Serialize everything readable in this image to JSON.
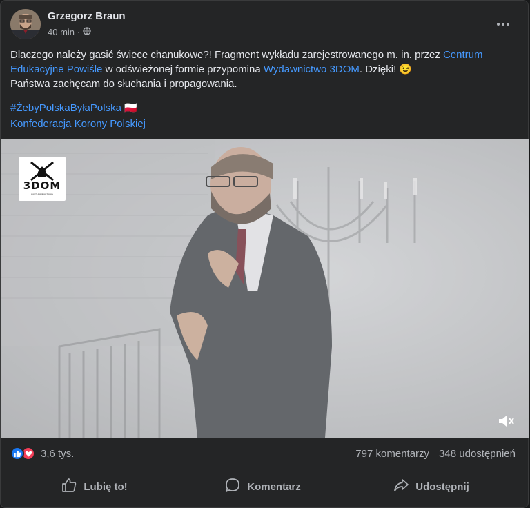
{
  "post": {
    "author": "Grzegorz Braun",
    "time": "40 min",
    "separator": "·",
    "visibility_icon": "globe-icon",
    "text_part1": "Dlaczego należy gasić świece chanukowe?! Fragment wykładu zarejestrowanego m. in. przez ",
    "link1": "Centrum Edukacyjne Powiśle",
    "text_part2": " w odświeżonej formie przypomina ",
    "link2": "Wydawnictwo 3DOM",
    "text_part3": ". Dzięki! 😉",
    "text_line2": "Państwa zachęcam do słuchania i propagowania.",
    "hashtag": "#ŻebyPolskaByłaPolska",
    "flag": "🇵🇱",
    "page_link": "Konfederacja Korony Polskiej"
  },
  "media": {
    "logo_text": "3DOM",
    "logo_sub": "WYDAWNICTWO",
    "mute_icon": "speaker-muted-icon"
  },
  "stats": {
    "reactions_count": "3,6 tys.",
    "comments": "797 komentarzy",
    "shares": "348 udostępnień"
  },
  "actions": {
    "like": "Lubię to!",
    "comment": "Komentarz",
    "share": "Udostępnij"
  },
  "colors": {
    "background": "#242526",
    "link": "#4599ff",
    "like": "#1877f2",
    "love": "#f33e58"
  }
}
